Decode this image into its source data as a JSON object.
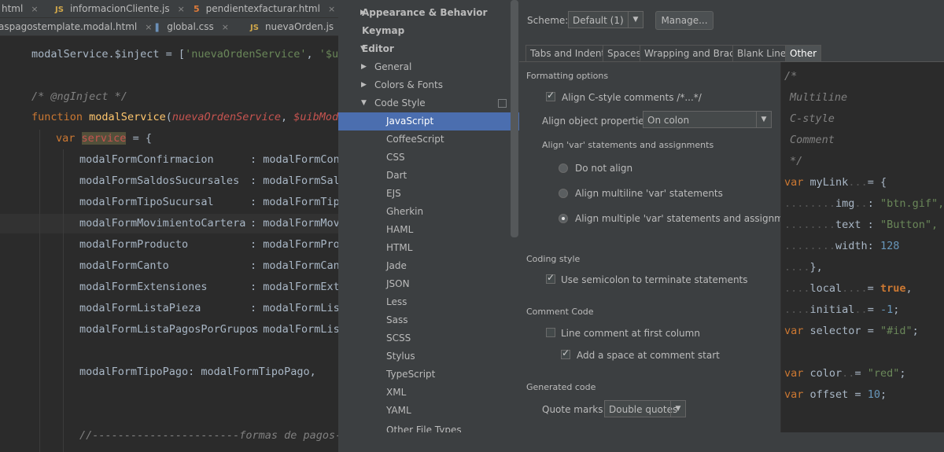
{
  "editor": {
    "tabs_row1": [
      {
        "icon": "html-icon",
        "label": "html"
      },
      {
        "icon": "js-file-icon",
        "prefix": "JS",
        "label": "informacionCliente.js"
      },
      {
        "icon": "html5-icon",
        "label": "pendientexfacturar.html"
      }
    ],
    "tabs_row2": [
      {
        "label": "aspagostemplate.modal.html"
      },
      {
        "icon": "css-file-icon",
        "label": "global.css"
      },
      {
        "icon": "js-file-icon",
        "prefix": "JS",
        "label": "nuevaOrden.js"
      }
    ],
    "close_glyph": "×",
    "code": {
      "inject_line": [
        "modalService.$inject = [",
        "'nuevaOrdenService'",
        ", ",
        "'$uibM"
      ],
      "comment_line": "/* @ngInject */",
      "function_kw": "function",
      "function_name": "modalService",
      "function_params": [
        "nuevaOrdenService",
        "$uibModal"
      ],
      "var_kw": "var",
      "var_name": "service",
      "var_rest": " = {",
      "properties": [
        {
          "name": "modalFormConfirmacion",
          "value": ": modalFormCon"
        },
        {
          "name": "modalFormSaldosSucursales",
          "value": ": modalFormSal"
        },
        {
          "name": "modalFormTipoSucursal",
          "value": ": modalFormTip"
        },
        {
          "name": "modalFormMovimientoCartera",
          "value": ": modalFormMov"
        },
        {
          "name": "modalFormProducto",
          "value": ": modalFormPro"
        },
        {
          "name": "modalFormCanto",
          "value": ": modalFormCan"
        },
        {
          "name": "modalFormExtensiones",
          "value": ": modalFormExt"
        },
        {
          "name": "modalFormListaPieza",
          "value": ": modalFormLis"
        },
        {
          "name": "modalFormListaPagosPorGrupos",
          "value": ": modalFormLis"
        }
      ],
      "tipo_pago_line": "modalFormTipoPago: modalFormTipoPago,",
      "divider_comment": "//-----------------------formas de pagos--"
    }
  },
  "settings_tree": {
    "items": [
      {
        "label": "Appearance & Behavior",
        "bold": true,
        "arrow": "▶"
      },
      {
        "label": "Keymap",
        "bold": true,
        "arrow": ""
      },
      {
        "label": "Editor",
        "bold": true,
        "arrow": "▼"
      },
      {
        "label": "General",
        "arrow": "▶"
      },
      {
        "label": "Colors & Fonts",
        "arrow": "▶"
      },
      {
        "label": "Code Style",
        "arrow": "▼"
      },
      {
        "label": "JavaScript",
        "selected": true
      },
      {
        "label": "CoffeeScript"
      },
      {
        "label": "CSS"
      },
      {
        "label": "Dart"
      },
      {
        "label": "EJS"
      },
      {
        "label": "Gherkin"
      },
      {
        "label": "HAML"
      },
      {
        "label": "HTML"
      },
      {
        "label": "Jade"
      },
      {
        "label": "JSON"
      },
      {
        "label": "Less"
      },
      {
        "label": "Sass"
      },
      {
        "label": "SCSS"
      },
      {
        "label": "Stylus"
      },
      {
        "label": "TypeScript"
      },
      {
        "label": "XML"
      },
      {
        "label": "YAML"
      },
      {
        "label": "Other File Types"
      }
    ]
  },
  "settings": {
    "scheme_label": "Scheme:",
    "scheme_value": "Default (1)",
    "manage_button": "Manage...",
    "tabs": [
      {
        "label": "Tabs and Indents"
      },
      {
        "label": "Spaces"
      },
      {
        "label": "Wrapping and Braces"
      },
      {
        "label": "Blank Lines"
      },
      {
        "label": "Other",
        "active": true
      }
    ],
    "formatting_header": "Formatting options",
    "align_c_comments": "Align C-style comments /*...*/",
    "align_c_comments_checked": true,
    "align_object_label": "Align object properties:",
    "align_object_value": "On colon",
    "align_var_header": "Align 'var' statements and assignments",
    "radio_options": [
      {
        "label": "Do not align",
        "selected": false
      },
      {
        "label": "Align multiline 'var' statements",
        "selected": false
      },
      {
        "label": "Align multiple 'var' statements and assignments",
        "selected": true
      }
    ],
    "coding_style_header": "Coding style",
    "use_semicolon": "Use semicolon to terminate statements",
    "use_semicolon_checked": true,
    "comment_code_header": "Comment Code",
    "line_comment": "Line comment at first column",
    "line_comment_checked": false,
    "add_space": "Add a space at comment start",
    "add_space_checked": true,
    "generated_code_header": "Generated code",
    "quote_marks_label": "Quote marks:",
    "quote_marks_value": "Double quotes"
  },
  "preview": {
    "c_open": "/*",
    "c_line1": "Multiline",
    "c_line2": "C-style",
    "c_line3": "Comment",
    "c_close": "*/",
    "kw_var": "var",
    "mylink": "myLink",
    "img_key": "img",
    "img_val": "\"btn.gif\",",
    "text_key": "text",
    "text_val": "\"Button\",",
    "width_key": "width",
    "width_val": "128",
    "close_brace": "},",
    "local_key": "local",
    "local_val": "true",
    "initial_key": "initial",
    "initial_val": "-1",
    "selector_name": "selector",
    "selector_val": "\"#id\"",
    "color_name": "color",
    "color_val": "\"red\"",
    "offset_name": "offset",
    "offset_val": "10"
  }
}
